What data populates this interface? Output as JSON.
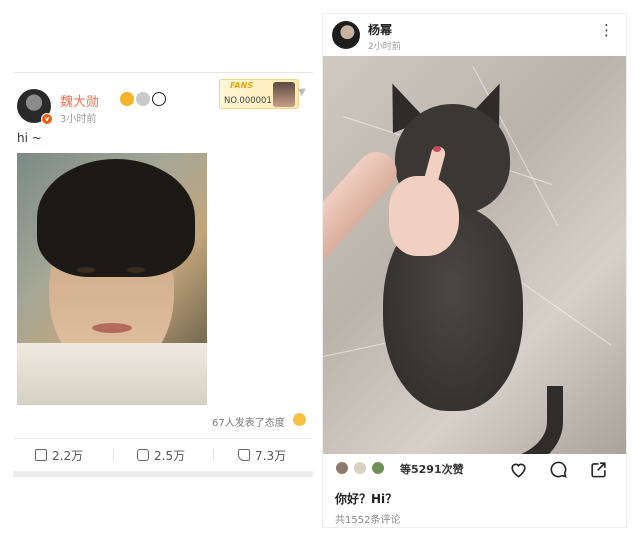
{
  "left_post": {
    "username": "魏大勋",
    "time": "3小时前",
    "fans_label": "FANS",
    "fans_number": "NO.000001",
    "text": "hi ~",
    "reactions": "67人发表了态度",
    "actions": {
      "repost": "2.2万",
      "comment": "2.5万",
      "like": "7.3万"
    }
  },
  "right_post": {
    "username": "杨幂",
    "time": "2小时前",
    "likes": "等5291次赞",
    "caption": "你好？Hi？",
    "comments": "共1552条评论"
  },
  "icons": {
    "more": "more-vertical-icon",
    "heart": "heart-icon",
    "comment": "comment-icon",
    "share": "share-icon",
    "repost": "repost-icon",
    "like": "thumb-up-icon"
  },
  "colors": {
    "weibo_name": "#eb7350",
    "verified": "#f25d0c"
  }
}
